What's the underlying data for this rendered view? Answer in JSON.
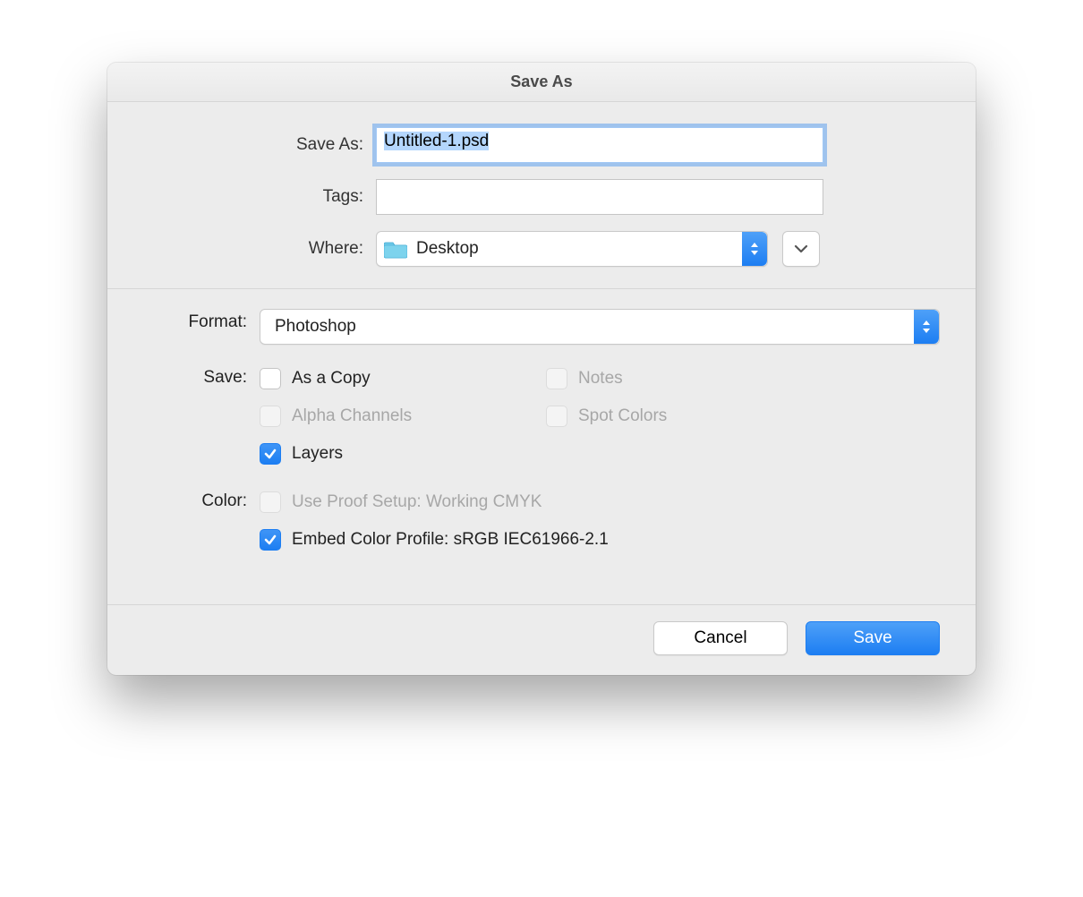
{
  "dialog": {
    "title": "Save As",
    "saveAsLabel": "Save As:",
    "filename": "Untitled-1.psd",
    "tagsLabel": "Tags:",
    "tagsValue": "",
    "whereLabel": "Where:",
    "whereValue": "Desktop"
  },
  "format": {
    "label": "Format:",
    "value": "Photoshop"
  },
  "save": {
    "label": "Save:",
    "asCopy": "As a Copy",
    "notes": "Notes",
    "alphaChannels": "Alpha Channels",
    "spotColors": "Spot Colors",
    "layers": "Layers"
  },
  "color": {
    "label": "Color:",
    "useProofSetup": "Use Proof Setup:  Working CMYK",
    "embedProfile": "Embed Color Profile:  sRGB IEC61966-2.1"
  },
  "buttons": {
    "cancel": "Cancel",
    "save": "Save"
  }
}
